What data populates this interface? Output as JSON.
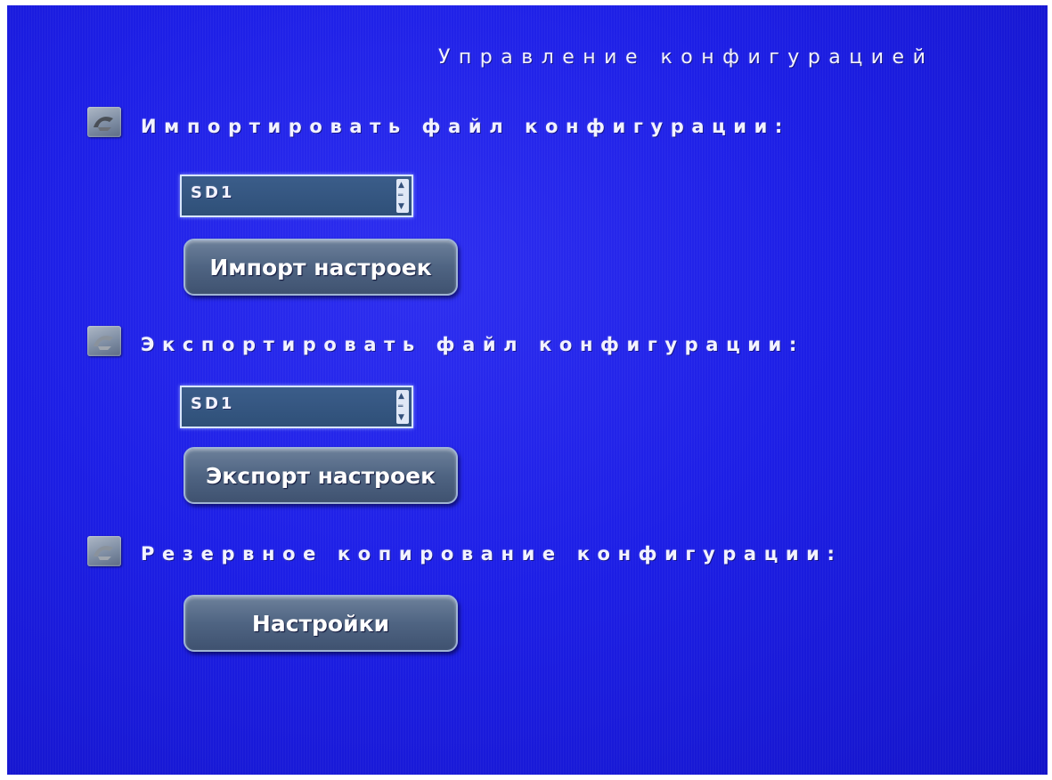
{
  "header": {
    "title": "Управление конфигурацией"
  },
  "sections": [
    {
      "label": "Импортировать файл конфигурации:",
      "icon": "import-config-icon",
      "select_value": "SD1",
      "button_label": "Импорт настроек"
    },
    {
      "label": "Экспортировать файл конфигурации:",
      "icon": "export-config-icon",
      "select_value": "SD1",
      "button_label": "Экспорт настроек"
    },
    {
      "label": "Резервное копирование конфигурации:",
      "icon": "backup-config-icon",
      "button_label": "Настройки"
    }
  ],
  "colors": {
    "background": "#1d1fe6",
    "text": "#f2f2ff",
    "button": "#4f6482",
    "select": "#2f5078"
  }
}
